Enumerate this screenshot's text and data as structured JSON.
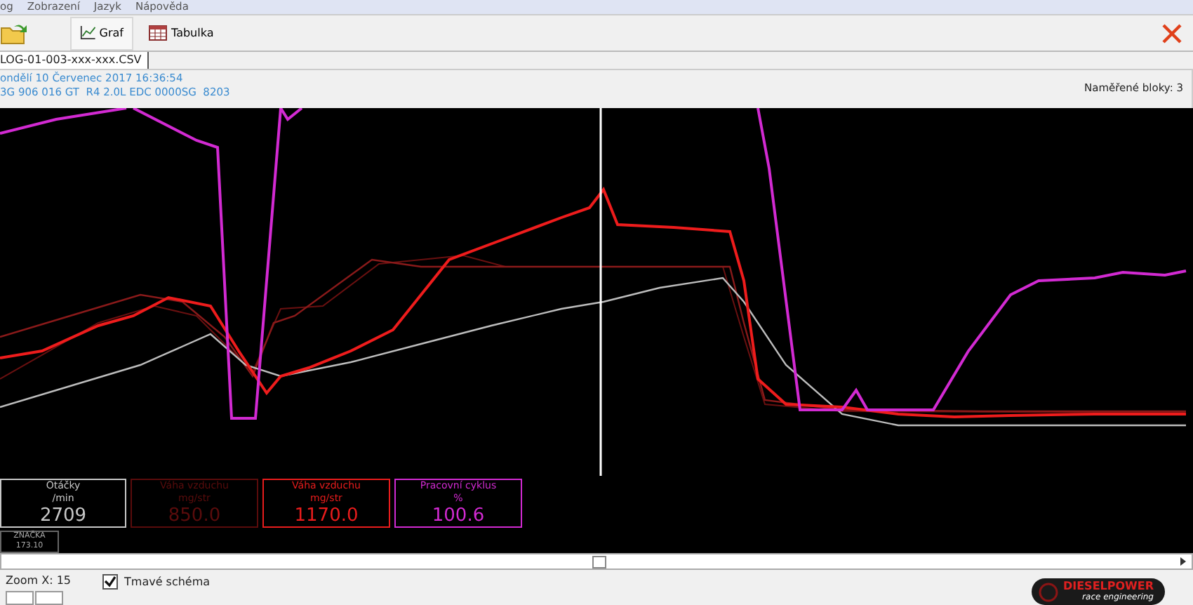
{
  "menu": [
    "og",
    "Zobrazení",
    "Jazyk",
    "Nápověda"
  ],
  "toolbar": [
    {
      "kind": "open"
    },
    {
      "kind": "chart",
      "label": "Graf",
      "selected": true
    },
    {
      "kind": "table",
      "label": "Tabulka",
      "selected": false
    }
  ],
  "tab": {
    "label": "LOG-01-003-xxx-xxx.CSV",
    "selected": true
  },
  "info": {
    "date": "ondělí 10 Červenec 2017 16:36:54",
    "ecu": "3G 906 016 GT  R4 2.0L EDC 0000SG  8203",
    "blocks": "Naměřené bloky: 3"
  },
  "readouts": [
    {
      "name": "Otáčky",
      "unit": "/min",
      "value": "2709",
      "color": "#c8c8c8"
    },
    {
      "name": "Váha vzduchu",
      "unit": "mg/str",
      "value": "850.0",
      "color": "#5a0c0c"
    },
    {
      "name": "Váha vzduchu",
      "unit": "mg/str",
      "value": "1170.0",
      "color": "#e81c1c"
    },
    {
      "name": "Pracovní cyklus",
      "unit": "%",
      "value": "100.6",
      "color": "#d22ad2"
    }
  ],
  "marker": {
    "label": "ZNAČKA",
    "value": "173.10"
  },
  "zoom": "Zoom X: 15",
  "dark_scheme": {
    "label": "Tmavé schéma",
    "checked": true
  },
  "logo": {
    "title": "DIESELPOWER",
    "subtitle": "race engineering"
  }
}
